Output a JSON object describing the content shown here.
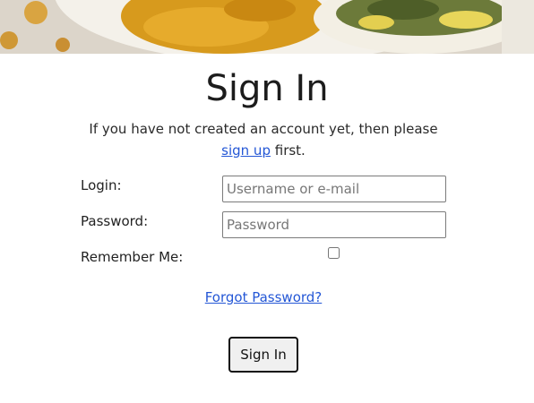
{
  "hero": {
    "image_desc": "food-photo-banner"
  },
  "page": {
    "title": "Sign In"
  },
  "intro": {
    "text_before": "If you have not created an account yet, then please",
    "signup_link": "sign up",
    "text_after": "first."
  },
  "form": {
    "login_label": "Login:",
    "login_placeholder": "Username or e-mail",
    "login_value": "",
    "password_label": "Password:",
    "password_placeholder": "Password",
    "password_value": "",
    "remember_label": "Remember Me:",
    "remember_checked": false
  },
  "forgot": {
    "link_text": "Forgot Password?"
  },
  "submit": {
    "label": "Sign In"
  },
  "colors": {
    "link": "#2457d6",
    "text": "#222222"
  }
}
